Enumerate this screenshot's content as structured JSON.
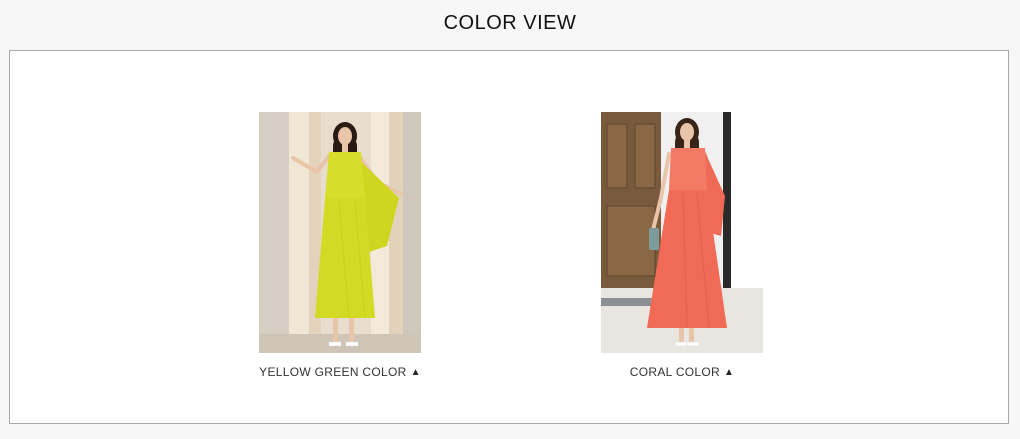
{
  "title": "COLOR VIEW",
  "items": [
    {
      "caption": "YELLOW GREEN COLOR",
      "arrow_icon": "triangle-up-icon",
      "dress_color": "#d6dd2a",
      "background": "curtain-room"
    },
    {
      "caption": "CORAL COLOR",
      "arrow_icon": "triangle-up-icon",
      "dress_color": "#f06a55",
      "background": "wooden-door"
    }
  ],
  "colors": {
    "page_background": "#f7f7f7",
    "frame_border": "#a9a9a9",
    "frame_background": "#ffffff",
    "text": "#333333"
  }
}
